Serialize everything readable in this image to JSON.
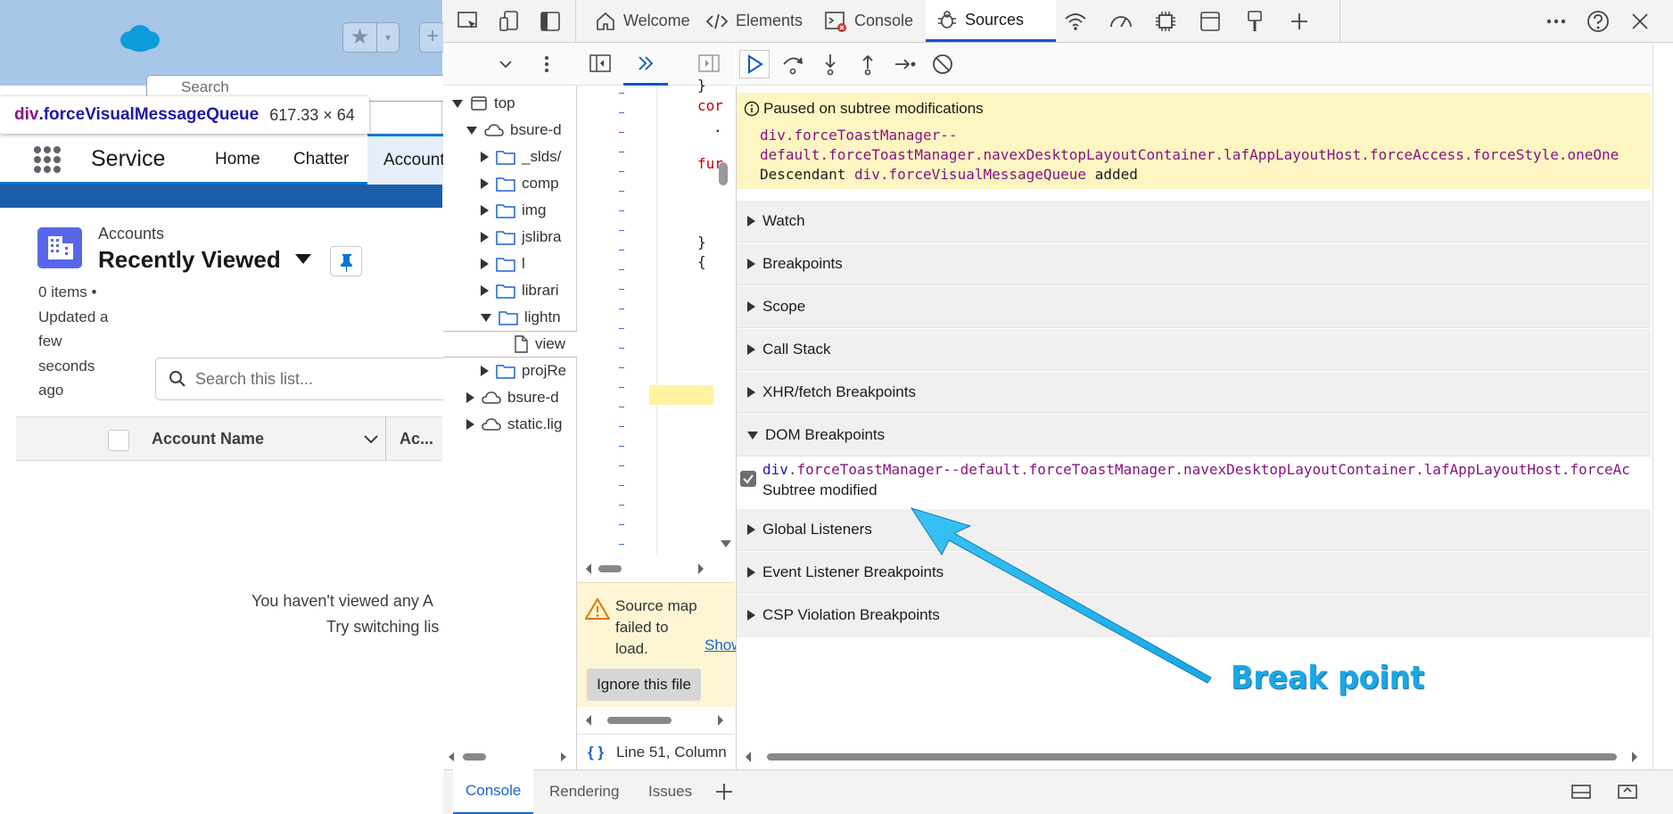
{
  "salesforce": {
    "favorites_star": "★",
    "favorites_chevron": "▾",
    "search_placeholder": "Search",
    "tooltip": {
      "tag": "div",
      "class": ".forceVisualMessageQueue",
      "size": "617.33 × 64"
    },
    "app_name": "Service",
    "nav": {
      "home": "Home",
      "chatter": "Chatter",
      "accounts": "Accounts"
    },
    "object_label": "Accounts",
    "list_view": "Recently Viewed",
    "list_meta_lines": [
      "0 items •",
      "Updated a",
      "few",
      "seconds",
      "ago"
    ],
    "list_search_placeholder": "Search this list...",
    "table": {
      "col1": "Account Name",
      "col2": "Ac..."
    },
    "empty_line1": "You haven't viewed any A",
    "empty_line2": "Try switching lis"
  },
  "devtools": {
    "tabs": {
      "welcome": "Welcome",
      "elements": "Elements",
      "console": "Console",
      "sources": "Sources"
    },
    "navigator": {
      "rows": [
        {
          "label": "top",
          "indent": 0,
          "state": "open",
          "icon": "frame-icon"
        },
        {
          "label": "bsure-d",
          "indent": 1,
          "state": "open",
          "icon": "cloud-icon"
        },
        {
          "label": "_slds/",
          "indent": 2,
          "state": "closed",
          "icon": "folder-icon"
        },
        {
          "label": "comp",
          "indent": 2,
          "state": "closed",
          "icon": "folder-icon"
        },
        {
          "label": "img",
          "indent": 2,
          "state": "closed",
          "icon": "folder-icon"
        },
        {
          "label": "jslibra",
          "indent": 2,
          "state": "closed",
          "icon": "folder-icon"
        },
        {
          "label": "l",
          "indent": 2,
          "state": "closed",
          "icon": "folder-icon"
        },
        {
          "label": "librari",
          "indent": 2,
          "state": "closed",
          "icon": "folder-icon"
        },
        {
          "label": "lightn",
          "indent": 2,
          "state": "open",
          "icon": "folder-icon"
        },
        {
          "label": "view",
          "indent": 3,
          "state": "none",
          "icon": "file-icon"
        },
        {
          "label": "projRe",
          "indent": 2,
          "state": "closed",
          "icon": "folder-icon"
        },
        {
          "label": "bsure-d",
          "indent": 1,
          "state": "closed",
          "icon": "cloud-icon"
        },
        {
          "label": "static.lig",
          "indent": 1,
          "state": "closed",
          "icon": "cloud-icon"
        }
      ]
    },
    "editor": {
      "code_lines": [
        "}",
        "cor",
        ".",
        "fur",
        "}",
        "{"
      ],
      "source_map_warning": "Source map failed to load.",
      "show_link": "Show",
      "ignore_button": "Ignore this file",
      "status": "Line 51, Column",
      "braces": "{ }"
    },
    "debugger": {
      "paused_title": "Paused on subtree modifications",
      "paused_selector_l1": "div.forceToastManager--",
      "paused_selector_l2": "default.forceToastManager.navexDesktopLayoutContainer.lafAppLayoutHost.forceAccess.forceStyle.oneOne",
      "paused_l3_prefix": "Descendant",
      "paused_l3_node": "div.forceVisualMessageQueue",
      "paused_l3_suffix": "added",
      "sections": {
        "watch": "Watch",
        "breakpoints": "Breakpoints",
        "scope": "Scope",
        "call_stack": "Call Stack",
        "xhr": "XHR/fetch Breakpoints",
        "dom": "DOM Breakpoints",
        "global": "Global Listeners",
        "event": "Event Listener Breakpoints",
        "csp": "CSP Violation Breakpoints"
      },
      "dom_breakpoint": {
        "node_tag": "div",
        "node_classes": ".forceToastManager--default.forceToastManager.navexDesktopLayoutContainer.lafAppLayoutHost.forceAc",
        "type": "Subtree modified",
        "checked": true
      }
    },
    "drawer": {
      "console": "Console",
      "rendering": "Rendering",
      "issues": "Issues"
    }
  },
  "annotation": {
    "label": "Break point",
    "color": "#1aa7e6"
  }
}
